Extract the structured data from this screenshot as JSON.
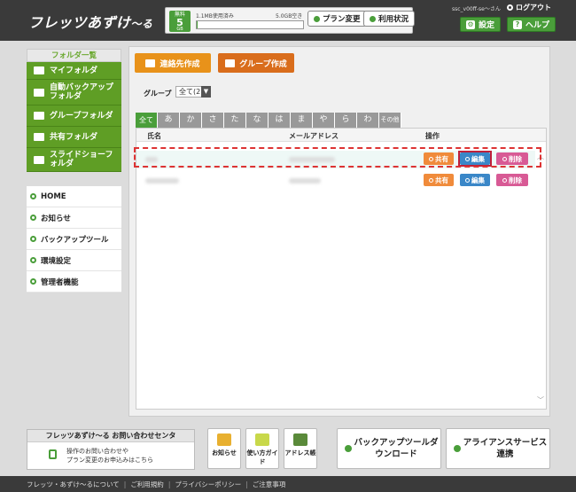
{
  "header": {
    "logo_main": "フレッツあずけ",
    "logo_tail": "〜る",
    "plan": {
      "line1": "無料",
      "size": "5",
      "unit": "GB"
    },
    "usage_used": "1.1MB使用済み",
    "usage_free": "5.0GB空き",
    "usage_fraction": 0.0002,
    "plan_change": "プラン変更",
    "usage_status": "利用状況",
    "user": "ssc_v00ff-se〜さん",
    "logout": "ログアウト",
    "settings": "設定",
    "help": "ヘルプ"
  },
  "sidebar": {
    "folders_title": "フォルダ一覧",
    "folders": [
      {
        "label": "マイフォルダ"
      },
      {
        "label": "自動バックアップフォルダ"
      },
      {
        "label": "グループフォルダ"
      },
      {
        "label": "共有フォルダ"
      },
      {
        "label": "スライドショーフォルダ"
      }
    ],
    "nav": [
      {
        "label": "HOME"
      },
      {
        "label": "お知らせ"
      },
      {
        "label": "バックアップツール"
      },
      {
        "label": "環境設定"
      },
      {
        "label": "管理者機能"
      }
    ]
  },
  "main": {
    "add_contact": "連絡先作成",
    "create_group": "グループ作成",
    "group_label": "グループ",
    "group_value": "全て(2)",
    "tabs": [
      "全て",
      "あ",
      "か",
      "さ",
      "た",
      "な",
      "は",
      "ま",
      "や",
      "ら",
      "わ",
      "その他"
    ],
    "columns": {
      "name": "氏名",
      "email": "メールアドレス",
      "ops": "操作"
    },
    "row_actions": {
      "share": "共有",
      "edit": "編集",
      "delete": "削除"
    }
  },
  "footer": {
    "contact_title": "フレッツあずけ〜る お問い合わせセンタ",
    "contact_line1": "操作のお問い合わせや",
    "contact_line2": "プラン変更のお申込みはこちら",
    "icons": [
      {
        "label": "お知らせ"
      },
      {
        "label": "使い方ガイド"
      },
      {
        "label": "アドレス帳"
      }
    ],
    "backup_tool": "バックアップツールダウンロード",
    "alliance": "アライアンスサービス連携",
    "links": [
      "フレッツ・あずけ〜るについて",
      "ご利用規約",
      "プライバシーポリシー",
      "ご注意事項"
    ]
  },
  "colors": {
    "green": "#4a9e3a",
    "orange": "#e8921a",
    "header": "#3a3a3a"
  }
}
